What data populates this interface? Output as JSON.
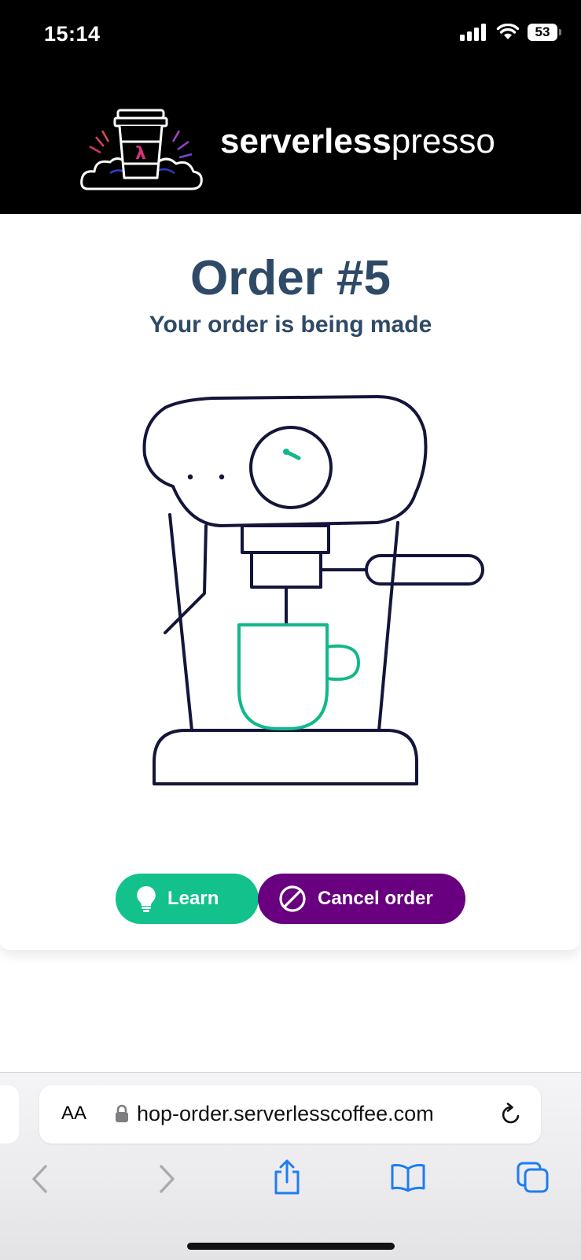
{
  "status_bar": {
    "time": "15:14",
    "battery": "53"
  },
  "header": {
    "logo_bold": "serverless",
    "logo_light": "presso",
    "logo_mark": "λ"
  },
  "order": {
    "title": "Order #5",
    "status": "Your order is being made"
  },
  "actions": {
    "learn_label": "Learn",
    "cancel_label": "Cancel order"
  },
  "browser": {
    "text_size_label": "AA",
    "url": "hop-order.serverlesscoffee.com"
  },
  "colors": {
    "heading": "#2f4a66",
    "learn_button": "#13c18c",
    "cancel_button": "#68007f",
    "cup": "#13b88a",
    "machine_outline": "#14153a",
    "safari_blue": "#1e7cf2"
  }
}
